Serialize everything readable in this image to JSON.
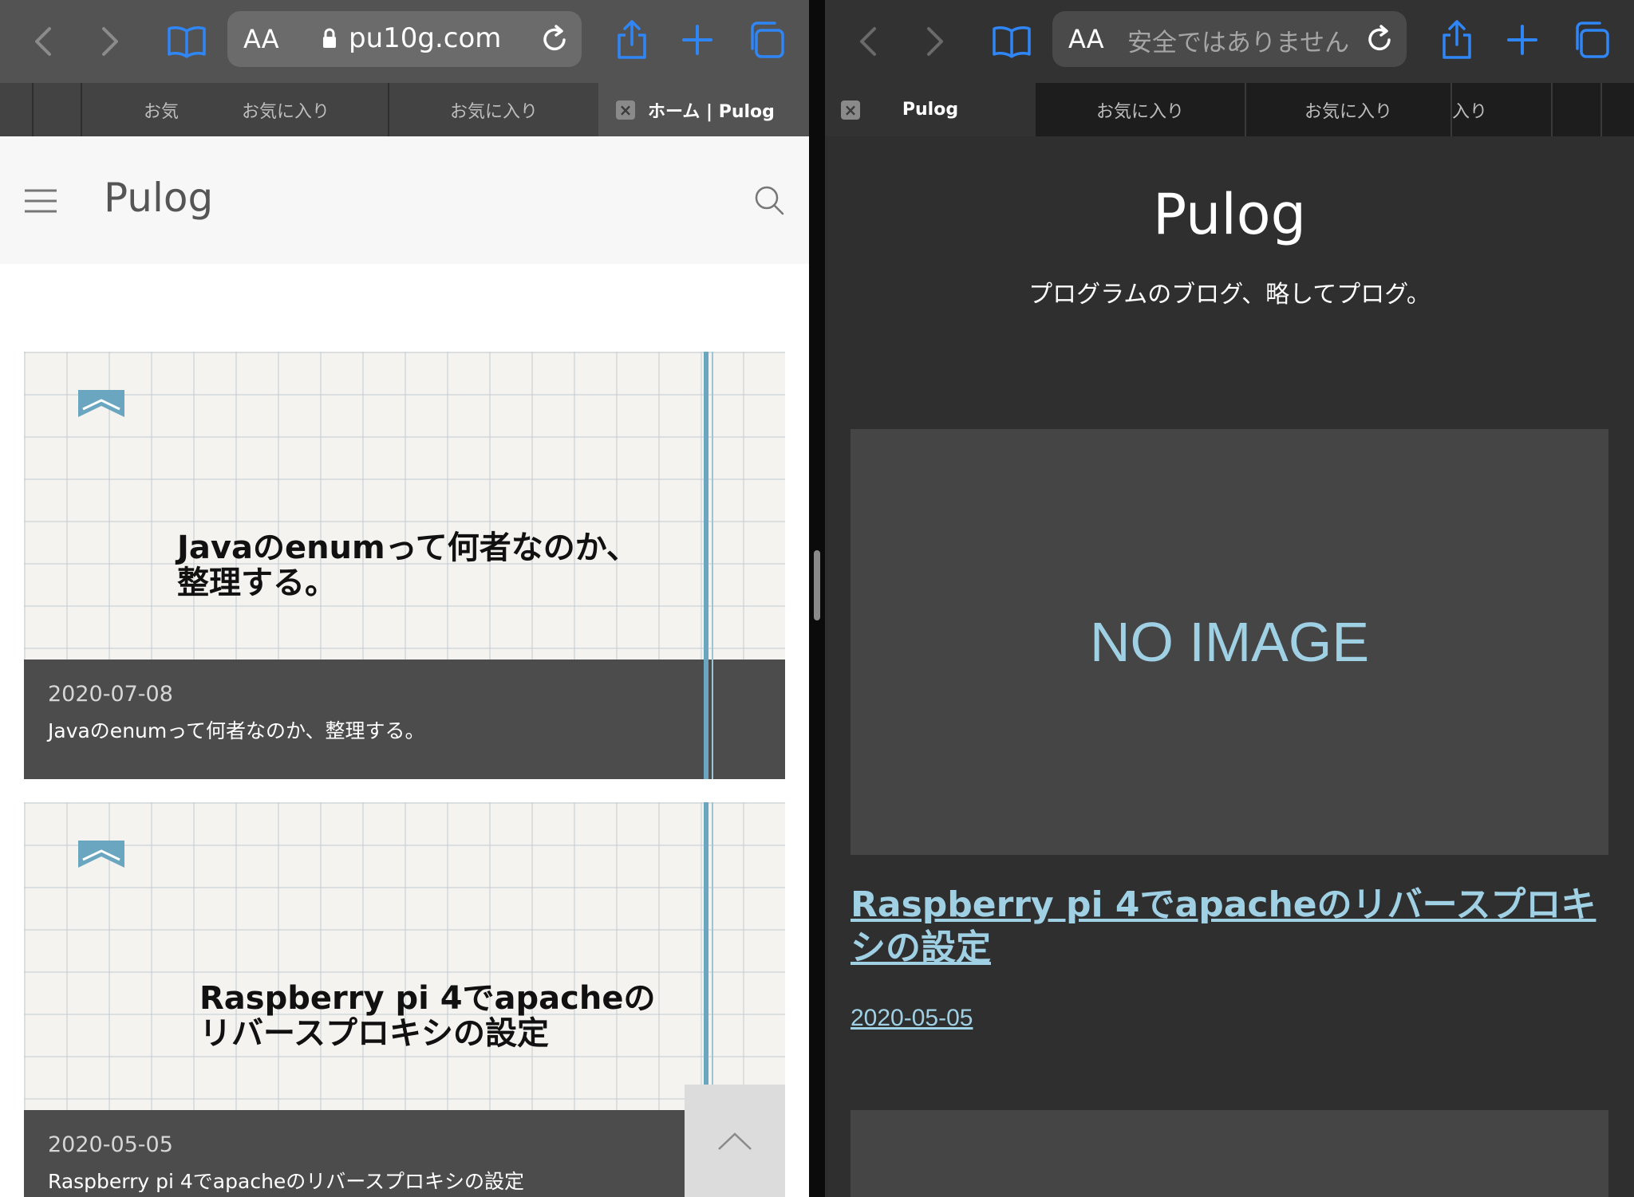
{
  "left": {
    "address": {
      "aa": "AA",
      "host": "pu10g.com"
    },
    "tabs": [
      {
        "label": "お気"
      },
      {
        "label": "お気に入り"
      },
      {
        "label": "お気に入り"
      },
      {
        "label": "ホーム | Pulog",
        "active": true
      }
    ],
    "site": {
      "title": "Pulog"
    },
    "posts": [
      {
        "image_title_line1": "Javaのenumって何者なのか、",
        "image_title_line2": "整理する。",
        "date": "2020-07-08",
        "title": "Javaのenumって何者なのか、整理する。"
      },
      {
        "image_title_line1": "Raspberry pi 4でapacheの",
        "image_title_line2": "リバースプロキシの設定",
        "date": "2020-05-05",
        "title": "Raspberry pi 4でapacheのリバースプロキシの設定"
      }
    ]
  },
  "right": {
    "address": {
      "aa": "AA",
      "status": "安全ではありません"
    },
    "tabs": [
      {
        "label": "Pulog",
        "active": true
      },
      {
        "label": "お気に入り"
      },
      {
        "label": "お気に入り"
      },
      {
        "label": "入り"
      }
    ],
    "site": {
      "title": "Pulog",
      "tagline": "プログラムのブログ、略してプログ。"
    },
    "post": {
      "image_placeholder": "NO IMAGE",
      "title_line1": "Raspberry pi 4でapacheのリバースプロキ",
      "title_line2": "シの設定",
      "date": "2020-05-05"
    }
  },
  "colors": {
    "accent_blue": "#2f86f6",
    "link_blue": "#9fd0e4",
    "card_stripe": "#6aa6bf"
  }
}
